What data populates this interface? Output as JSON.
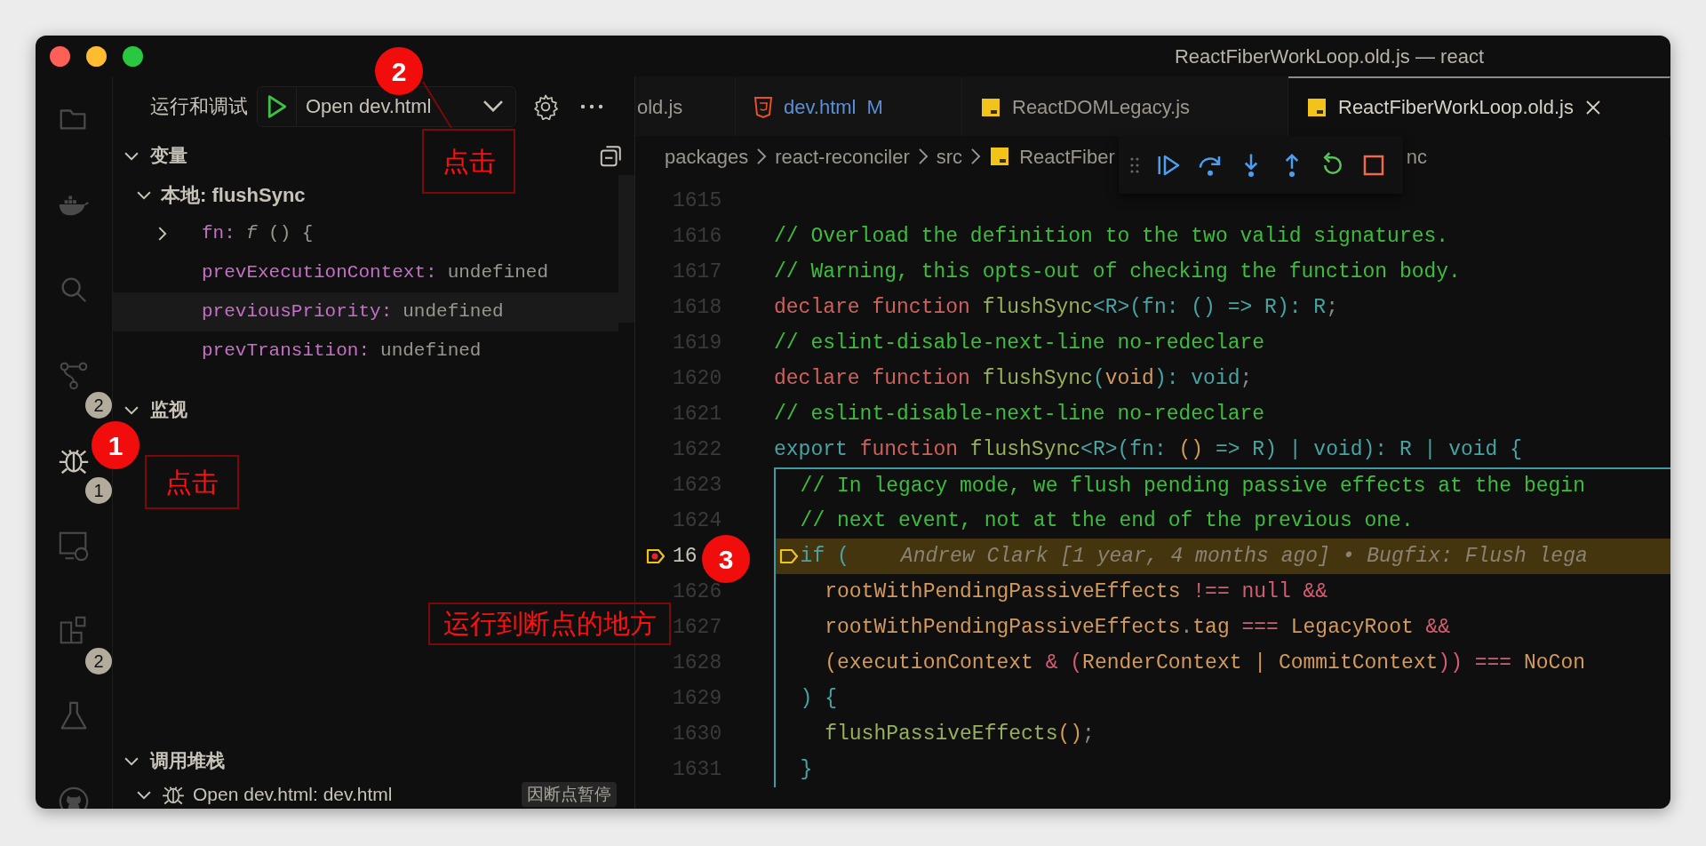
{
  "window": {
    "title": "ReactFiberWorkLoop.old.js — react"
  },
  "activity_bar": [
    {
      "kind": "files",
      "selected": false
    },
    {
      "kind": "docker",
      "selected": false
    },
    {
      "kind": "search",
      "selected": false
    },
    {
      "kind": "source-control",
      "selected": false,
      "badge": "2"
    },
    {
      "kind": "debug",
      "selected": true,
      "badge": "1"
    },
    {
      "kind": "remote",
      "selected": false
    },
    {
      "kind": "extensions",
      "selected": false,
      "badge": "2"
    },
    {
      "kind": "testing",
      "selected": false
    },
    {
      "kind": "github",
      "selected": false
    }
  ],
  "sidebar": {
    "title": "运行和调试",
    "launch_config": "Open dev.html",
    "variables": {
      "title": "变量",
      "expanded": true,
      "scope": "本地: flushSync",
      "items": [
        {
          "kind": "object",
          "name": "fn:",
          "value": "*f* () {",
          "selected": false
        },
        {
          "kind": "primitive",
          "name": "prevExecutionContext:",
          "value": "undefined",
          "selected": false
        },
        {
          "kind": "primitive",
          "name": "previousPriority:",
          "value": "undefined",
          "selected": true
        },
        {
          "kind": "primitive",
          "name": "prevTransition:",
          "value": "undefined",
          "selected": false
        }
      ]
    },
    "watch": {
      "title": "监视",
      "expanded": true
    },
    "call_stack": {
      "title": "调用堆栈",
      "expanded": true,
      "sessions": [
        {
          "name": "Open dev.html: dev.html",
          "status": "因断点暂停",
          "expanded": true
        }
      ]
    }
  },
  "tabs": [
    {
      "label": "old.js",
      "kind": "plain",
      "selected": false
    },
    {
      "label": "dev.html",
      "kind": "html",
      "modified": "M",
      "selected": false
    },
    {
      "label": "ReactDOMLegacy.js",
      "kind": "js",
      "selected": false
    },
    {
      "label": "ReactFiberWorkLoop.old.js",
      "kind": "js",
      "selected": true
    }
  ],
  "breadcrumbs": [
    {
      "label": "packages",
      "kind": "folder"
    },
    {
      "label": "react-reconciler",
      "kind": "folder"
    },
    {
      "label": "src",
      "kind": "folder"
    },
    {
      "label": "ReactFiber",
      "kind": "js"
    },
    {
      "label": "nc",
      "kind": "symbol"
    }
  ],
  "code": {
    "lines": [
      {
        "number": "1615",
        "in_scope": false,
        "paused": false,
        "breakpoint": false
      },
      {
        "number": "1616",
        "in_scope": false,
        "paused": false,
        "breakpoint": false,
        "tokens": [
          {
            "text": "// Overload the definition to the two valid signatures.",
            "kind": "comment"
          }
        ]
      },
      {
        "number": "1617",
        "in_scope": false,
        "paused": false,
        "breakpoint": false,
        "tokens": [
          {
            "text": "// Warning, this opts-out of checking the function body.",
            "kind": "comment"
          }
        ]
      },
      {
        "number": "1618",
        "in_scope": false,
        "paused": false,
        "breakpoint": false,
        "tokens": [
          {
            "text": "declare function ",
            "kind": "keyword"
          },
          {
            "text": "flushSync",
            "kind": "function"
          },
          {
            "text": "<R>(fn: () => R): R",
            "kind": "type"
          },
          {
            "text": ";",
            "kind": "punct"
          }
        ]
      },
      {
        "number": "1619",
        "in_scope": false,
        "paused": false,
        "breakpoint": false,
        "tokens": [
          {
            "text": "// eslint-disable-next-line no-redeclare",
            "kind": "comment"
          }
        ]
      },
      {
        "number": "1620",
        "in_scope": false,
        "paused": false,
        "breakpoint": false,
        "tokens": [
          {
            "text": "declare function ",
            "kind": "keyword"
          },
          {
            "text": "flushSync",
            "kind": "function"
          },
          {
            "text": "(",
            "kind": "type"
          },
          {
            "text": "void",
            "kind": "variable"
          },
          {
            "text": "): void",
            "kind": "type"
          },
          {
            "text": ";",
            "kind": "punct"
          }
        ]
      },
      {
        "number": "1621",
        "in_scope": false,
        "paused": false,
        "breakpoint": false,
        "tokens": [
          {
            "text": "// eslint-disable-next-line no-redeclare",
            "kind": "comment"
          }
        ]
      },
      {
        "number": "1622",
        "in_scope": false,
        "paused": false,
        "breakpoint": false,
        "tokens": [
          {
            "text": "export ",
            "kind": "type"
          },
          {
            "text": "function ",
            "kind": "keyword"
          },
          {
            "text": "flushSync",
            "kind": "function"
          },
          {
            "text": "<R>(fn: ",
            "kind": "type"
          },
          {
            "text": "()",
            "kind": "variable"
          },
          {
            "text": " => R) | void): R | void {",
            "kind": "type"
          }
        ]
      },
      {
        "number": "1623",
        "in_scope": true,
        "paused": false,
        "breakpoint": false,
        "tokens": [
          {
            "text": "  // In legacy mode, we flush pending passive effects at the begin",
            "kind": "comment"
          }
        ]
      },
      {
        "number": "1624",
        "in_scope": true,
        "paused": false,
        "breakpoint": false,
        "tokens": [
          {
            "text": "  // next event, not at the end of the previous one.",
            "kind": "comment"
          }
        ]
      },
      {
        "number": "16",
        "in_scope": true,
        "paused": true,
        "breakpoint": true,
        "tokens": [
          {
            "text": "  if (",
            "kind": "type"
          },
          {
            "text": "Andrew Clark [1 year, 4 months ago] • Bugfix: Flush lega",
            "kind": "blame"
          }
        ]
      },
      {
        "number": "1626",
        "in_scope": true,
        "paused": false,
        "breakpoint": false,
        "tokens": [
          {
            "text": "    rootWithPendingPassiveEffects ",
            "kind": "variable"
          },
          {
            "text": "!== null &&",
            "kind": "operator"
          }
        ]
      },
      {
        "number": "1627",
        "in_scope": true,
        "paused": false,
        "breakpoint": false,
        "tokens": [
          {
            "text": "    rootWithPendingPassiveEffects",
            "kind": "variable"
          },
          {
            "text": ".",
            "kind": "punct"
          },
          {
            "text": "tag ",
            "kind": "variable"
          },
          {
            "text": "=== ",
            "kind": "operator"
          },
          {
            "text": "LegacyRoot ",
            "kind": "variable"
          },
          {
            "text": "&&",
            "kind": "operator"
          }
        ]
      },
      {
        "number": "1628",
        "in_scope": true,
        "paused": false,
        "breakpoint": false,
        "tokens": [
          {
            "text": "    (executionContext ",
            "kind": "variable"
          },
          {
            "text": "& (",
            "kind": "operator"
          },
          {
            "text": "RenderContext | CommitContext",
            "kind": "variable"
          },
          {
            "text": "))",
            "kind": "operator"
          },
          {
            "text": " === ",
            "kind": "operator"
          },
          {
            "text": "NoCon",
            "kind": "variable"
          }
        ]
      },
      {
        "number": "1629",
        "in_scope": true,
        "paused": false,
        "breakpoint": false,
        "tokens": [
          {
            "text": "  ) {",
            "kind": "type"
          }
        ]
      },
      {
        "number": "1630",
        "in_scope": true,
        "paused": false,
        "breakpoint": false,
        "tokens": [
          {
            "text": "    flushPassiveEffects",
            "kind": "function"
          },
          {
            "text": "()",
            "kind": "variable"
          },
          {
            "text": ";",
            "kind": "punct"
          }
        ]
      },
      {
        "number": "1631",
        "in_scope": true,
        "paused": false,
        "breakpoint": false,
        "tokens": [
          {
            "text": "  }",
            "kind": "type"
          }
        ]
      }
    ]
  },
  "annotations": [
    {
      "kind": "step",
      "label": "2"
    },
    {
      "kind": "callout",
      "label": "点击"
    },
    {
      "kind": "step",
      "label": "1"
    },
    {
      "kind": "callout",
      "label": "点击"
    },
    {
      "kind": "step",
      "label": "3"
    },
    {
      "kind": "callout",
      "label": "运行到断点的地方"
    }
  ]
}
